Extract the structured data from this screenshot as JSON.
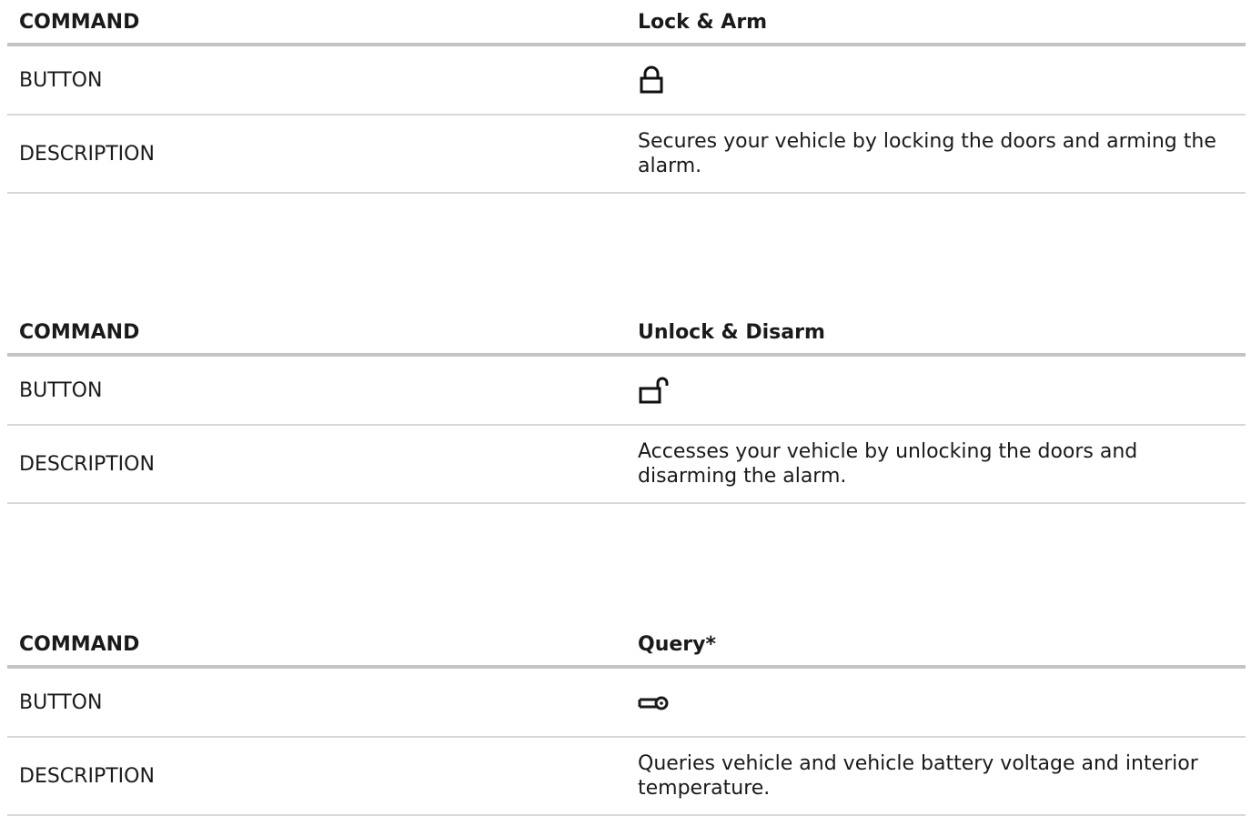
{
  "commands": [
    {
      "header_label": "COMMAND",
      "command_name": "Lock & Arm",
      "button_label": "BUTTON",
      "button_icon": "lock-closed-icon",
      "description_label": "DESCRIPTION",
      "description": "Secures your vehicle by locking the doors and arming the alarm."
    },
    {
      "header_label": "COMMAND",
      "command_name": "Unlock & Disarm",
      "button_label": "BUTTON",
      "button_icon": "lock-open-icon",
      "description_label": "DESCRIPTION",
      "description": "Accesses your vehicle by unlocking the doors and disarming the alarm."
    },
    {
      "header_label": "COMMAND",
      "command_name": "Query*",
      "button_label": "BUTTON",
      "button_icon": "key-icon",
      "description_label": "DESCRIPTION",
      "description": "Queries vehicle and vehicle battery voltage and interior temperature."
    }
  ],
  "colors": {
    "text": "#1a1a1a",
    "header_rule": "#c4c4c4",
    "row_rule": "#d8d8d8"
  }
}
